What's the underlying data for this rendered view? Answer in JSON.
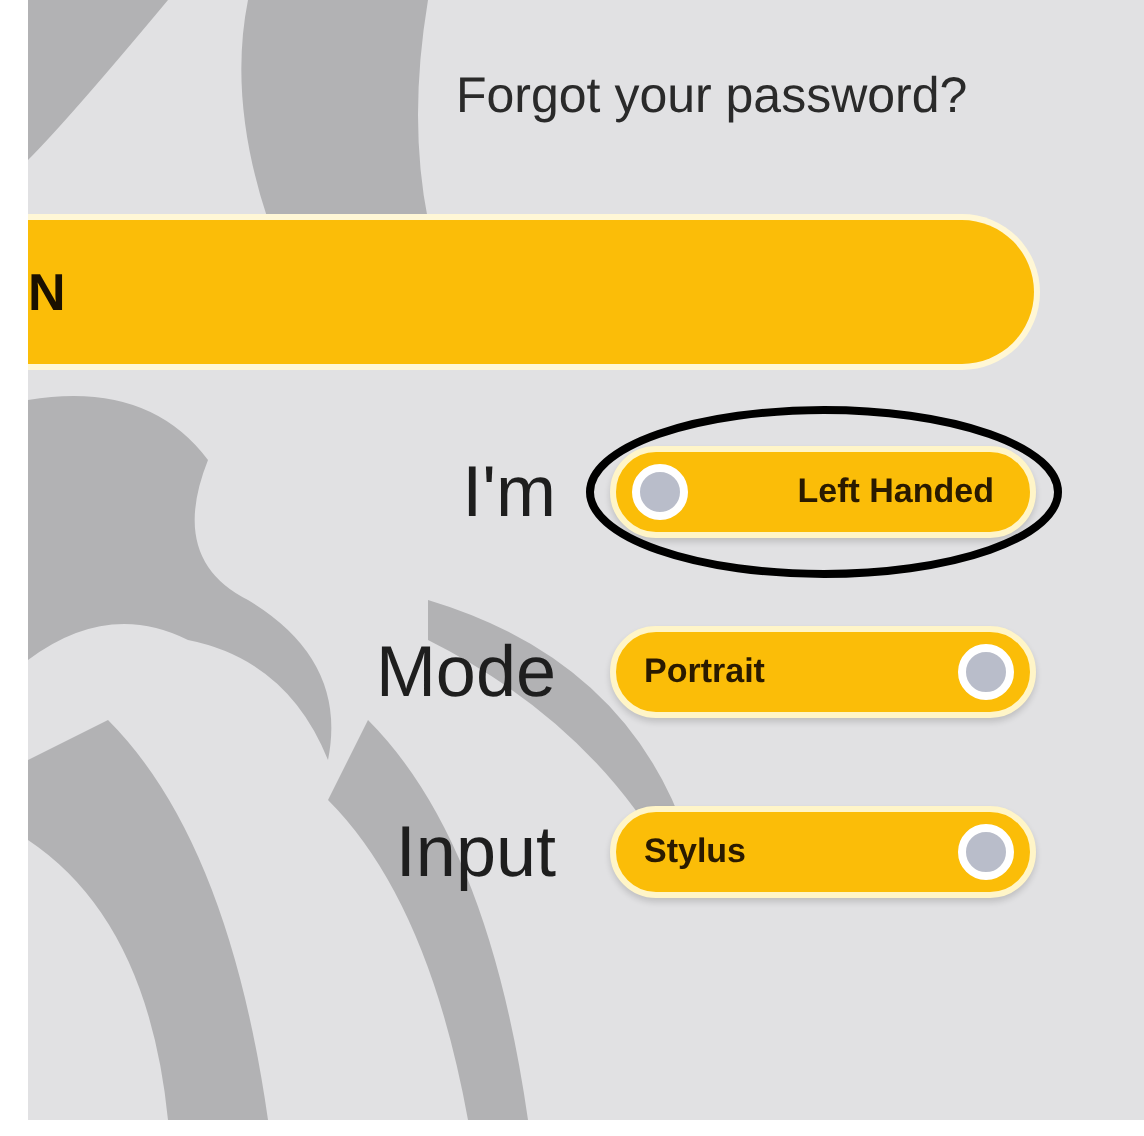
{
  "forgot_link": "Forgot your password?",
  "sign_in_button": {
    "label": "N"
  },
  "settings": [
    {
      "label": "I'm",
      "value": "Left Handed",
      "on": false,
      "circled": true
    },
    {
      "label": "Mode",
      "value": "Portrait",
      "on": true,
      "circled": false
    },
    {
      "label": "Input",
      "value": "Stylus",
      "on": true,
      "circled": false
    }
  ]
}
